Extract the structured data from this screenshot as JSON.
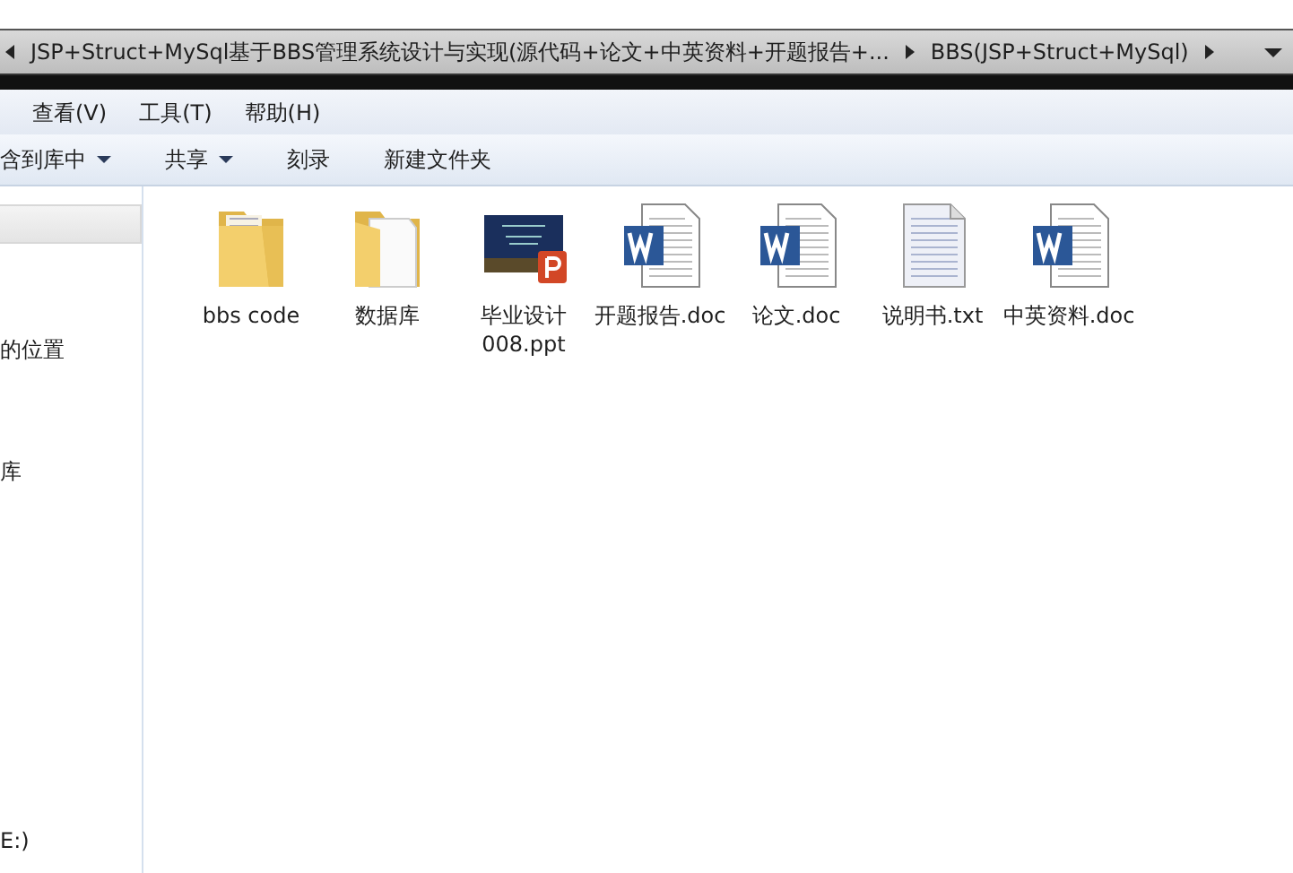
{
  "address_bar": {
    "segments": [
      {
        "label": "JSP+Struct+MySql基于BBS管理系统设计与实现(源代码+论文+中英资料+开题报告+..."
      },
      {
        "label": "BBS(JSP+Struct+MySql)"
      }
    ]
  },
  "menu_bar": [
    {
      "label": "查看(V)"
    },
    {
      "label": "工具(T)"
    },
    {
      "label": "帮助(H)"
    }
  ],
  "toolbar": [
    {
      "label": "含到库中",
      "has_menu": true
    },
    {
      "label": "共享",
      "has_menu": true
    },
    {
      "label": "刻录",
      "has_menu": false
    },
    {
      "label": "新建文件夹",
      "has_menu": false
    }
  ],
  "sidebar": {
    "items": [
      {
        "label": "的位置"
      },
      {
        "label": "库"
      },
      {
        "label": "E:)"
      }
    ]
  },
  "files": [
    {
      "kind": "folder",
      "name": "bbs code"
    },
    {
      "kind": "folder-docs",
      "name": "数据库"
    },
    {
      "kind": "ppt",
      "name": "毕业设计008.ppt"
    },
    {
      "kind": "doc",
      "name": "开题报告.doc"
    },
    {
      "kind": "doc",
      "name": "论文.doc"
    },
    {
      "kind": "txt",
      "name": "说明书.txt"
    },
    {
      "kind": "doc",
      "name": "中英资料.doc"
    }
  ]
}
